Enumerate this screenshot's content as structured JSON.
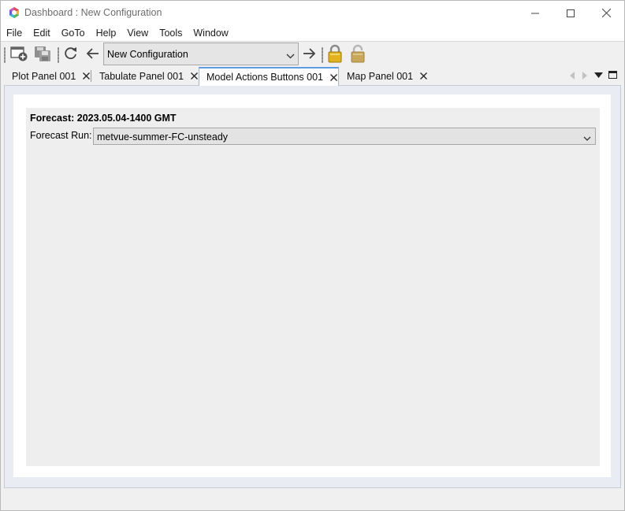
{
  "window": {
    "title": "Dashboard : New Configuration",
    "icon": "hexagon-app-icon",
    "controls": [
      "minimize-icon",
      "maximize-icon",
      "close-icon"
    ]
  },
  "menu": {
    "items": [
      "File",
      "Edit",
      "GoTo",
      "Help",
      "View",
      "Tools",
      "Window"
    ]
  },
  "toolbar": {
    "buttons": [
      "new-window-icon",
      "save-icon",
      "refresh-icon",
      "back-arrow-icon",
      "forward-arrow-icon",
      "lock-icon",
      "unlock-icon"
    ],
    "configuration_value": "New Configuration"
  },
  "tabs": [
    {
      "label": "Plot Panel 001",
      "active": false
    },
    {
      "label": "Tabulate Panel 001",
      "active": false
    },
    {
      "label": "Model Actions Buttons 001",
      "active": true
    },
    {
      "label": "Map Panel 001",
      "active": false
    }
  ],
  "panel": {
    "forecast_header": "Forecast: 2023.05.04-1400 GMT",
    "forecast_run_label": "Forecast Run:",
    "forecast_run_value": "metvue-summer-FC-unsteady"
  },
  "colors": {
    "accent": "#5f9be0",
    "lock_gold": "#e3b11d",
    "lock_dimmed": "#c8a65a"
  }
}
